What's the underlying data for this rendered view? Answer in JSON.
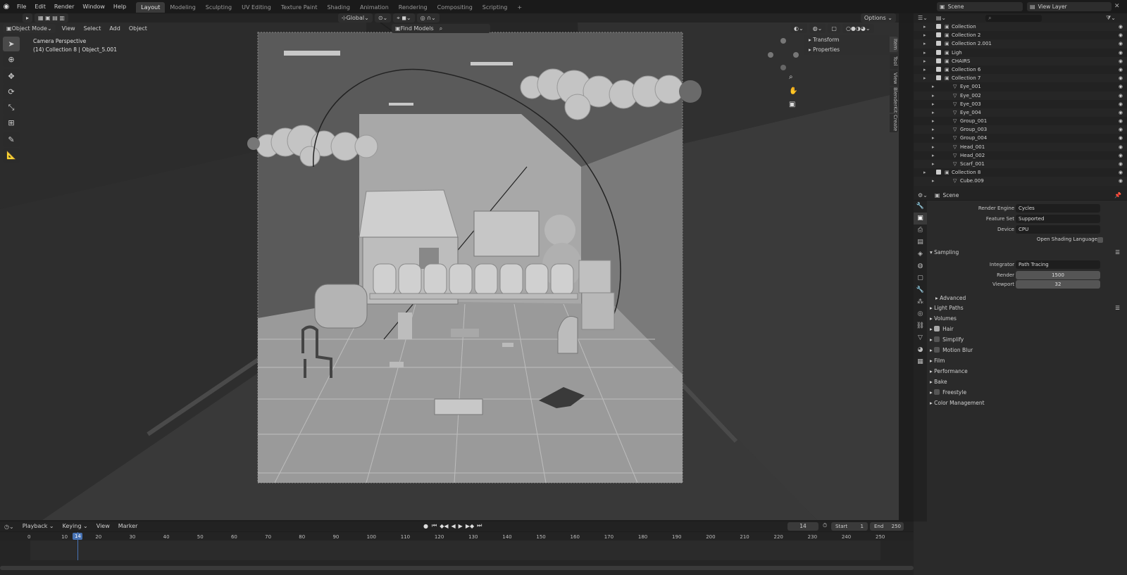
{
  "topbar": {
    "menus": [
      "File",
      "Edit",
      "Render",
      "Window",
      "Help"
    ],
    "workspaces": [
      "Layout",
      "Modeling",
      "Sculpting",
      "UV Editing",
      "Texture Paint",
      "Shading",
      "Animation",
      "Rendering",
      "Compositing",
      "Scripting",
      "+"
    ],
    "active_workspace": "Layout",
    "scene": "Scene",
    "view_layer": "View Layer"
  },
  "toolbar": {
    "orientation": "Global",
    "options": "Options",
    "find_models": "Find Models"
  },
  "viewport_header": {
    "mode": "Object Mode",
    "menus": [
      "View",
      "Select",
      "Add",
      "Object"
    ]
  },
  "viewport": {
    "perspective": "Camera Perspective",
    "collection_info": "(14) Collection 8 | Object_5.001",
    "npanel": {
      "items": [
        "Transform",
        "Properties"
      ]
    },
    "side_tabs": [
      "Item",
      "Tool",
      "View",
      "BlenderKit",
      "Create"
    ]
  },
  "outliner": {
    "rows": [
      {
        "name": "Collection",
        "depth": 0
      },
      {
        "name": "Collection 2",
        "depth": 0
      },
      {
        "name": "Collection 2.001",
        "depth": 0
      },
      {
        "name": "Ligh",
        "depth": 0
      },
      {
        "name": "CHAIRS",
        "depth": 0
      },
      {
        "name": "Collection 6",
        "depth": 0
      },
      {
        "name": "Collection 7",
        "depth": 0
      },
      {
        "name": "Eye_001",
        "depth": 1
      },
      {
        "name": "Eye_002",
        "depth": 1
      },
      {
        "name": "Eye_003",
        "depth": 1
      },
      {
        "name": "Eye_004",
        "depth": 1
      },
      {
        "name": "Group_001",
        "depth": 1
      },
      {
        "name": "Group_003",
        "depth": 1
      },
      {
        "name": "Group_004",
        "depth": 1
      },
      {
        "name": "Head_001",
        "depth": 1
      },
      {
        "name": "Head_002",
        "depth": 1
      },
      {
        "name": "Scarf_001",
        "depth": 1
      },
      {
        "name": "Collection 8",
        "depth": 0
      },
      {
        "name": "Cube.009",
        "depth": 1
      }
    ]
  },
  "properties": {
    "context": "Scene",
    "render_engine": {
      "label": "Render Engine",
      "value": "Cycles"
    },
    "feature_set": {
      "label": "Feature Set",
      "value": "Supported"
    },
    "device": {
      "label": "Device",
      "value": "CPU"
    },
    "osl": "Open Shading Language",
    "sampling": "Sampling",
    "integrator": {
      "label": "Integrator",
      "value": "Path Tracing"
    },
    "render_samples": {
      "label": "Render",
      "value": "1500"
    },
    "viewport_samples": {
      "label": "Viewport",
      "value": "32"
    },
    "advanced": "Advanced",
    "light_paths": "Light Paths",
    "volumes": "Volumes",
    "hair": "Hair",
    "simplify": "Simplify",
    "motion_blur": "Motion Blur",
    "film": "Film",
    "performance": "Performance",
    "bake": "Bake",
    "freestyle": "Freestyle",
    "color_management": "Color Management"
  },
  "timeline": {
    "menus": [
      "Playback",
      "Keying",
      "View",
      "Marker"
    ],
    "current_frame": "14",
    "start_label": "Start",
    "start": "1",
    "end_label": "End",
    "end": "250",
    "ticks": [
      "0",
      "10",
      "20",
      "30",
      "40",
      "50",
      "60",
      "70",
      "80",
      "90",
      "100",
      "110",
      "120",
      "130",
      "140",
      "150",
      "160",
      "170",
      "180",
      "190",
      "200",
      "210",
      "220",
      "230",
      "240",
      "250"
    ]
  },
  "colors": {
    "bg": "#262626",
    "accent": "#4772b3"
  }
}
